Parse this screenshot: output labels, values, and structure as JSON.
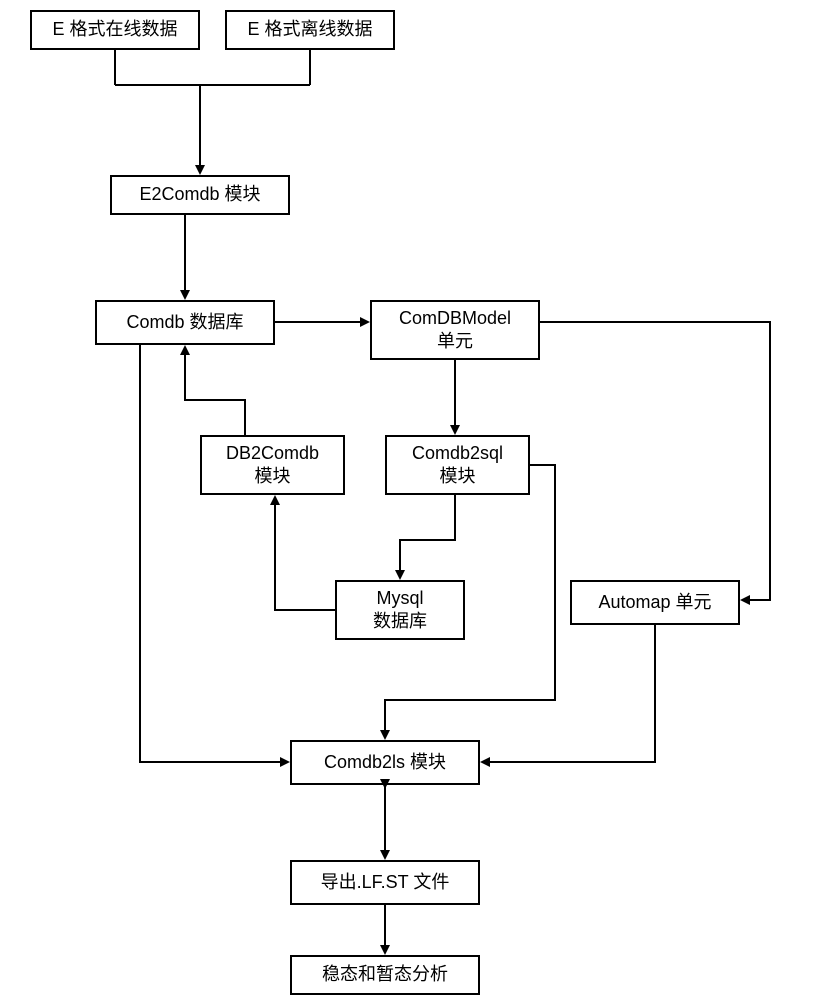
{
  "nodes": {
    "e_online": "E 格式在线数据",
    "e_offline": "E 格式离线数据",
    "e2comdb": "E2Comdb 模块",
    "comdb_db": "Comdb 数据库",
    "comdbmodel_l1": "ComDBModel",
    "comdbmodel_l2": "单元",
    "db2comdb_l1": "DB2Comdb",
    "db2comdb_l2": "模块",
    "comdb2sql_l1": "Comdb2sql",
    "comdb2sql_l2": "模块",
    "mysql_l1": "Mysql",
    "mysql_l2": "数据库",
    "automap": "Automap 单元",
    "comdb2ls": "Comdb2ls 模块",
    "export": "导出.LF.ST 文件",
    "analysis": "稳态和暂态分析"
  }
}
